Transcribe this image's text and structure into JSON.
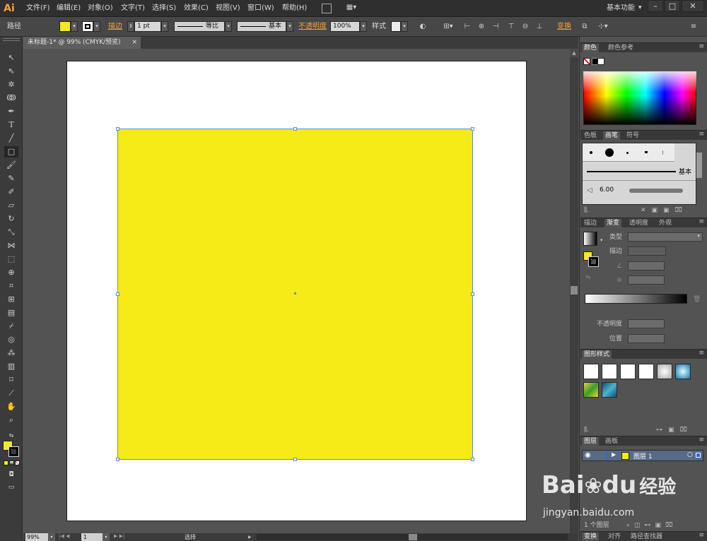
{
  "menubar": {
    "logo": "Ai",
    "items": [
      "文件(F)",
      "编辑(E)",
      "对象(O)",
      "文字(T)",
      "选择(S)",
      "效果(C)",
      "视图(V)",
      "窗口(W)",
      "帮助(H)"
    ],
    "workspace": "基本功能",
    "window_buttons": [
      "–",
      "□",
      "✕"
    ]
  },
  "control_bar": {
    "selection_label": "路径",
    "fill_color": "#f5eb17",
    "stroke_label": "描边",
    "stroke_weight": "1 pt",
    "stroke_profile": "等比",
    "brush_def": "基本",
    "opacity_label": "不透明度",
    "opacity_value": "100%",
    "style_label": "样式",
    "transform_label": "变换"
  },
  "document": {
    "tab_title": "未标题-1* @ 99% (CMYK/预览)",
    "tab_close": "×"
  },
  "canvas": {
    "fill_color": "#f5eb17",
    "selection_color": "#5b8ed6"
  },
  "status": {
    "zoom": "99%",
    "artboard_number": "1",
    "tool_hint": "选择"
  },
  "panels": {
    "color": {
      "tabs": [
        "颜色",
        "颜色参考"
      ]
    },
    "brushes": {
      "tabs": [
        "色板",
        "画笔",
        "符号"
      ],
      "basic_label": "基本",
      "size_value": "6.00"
    },
    "gradient": {
      "tabs": [
        "描边",
        "渐变",
        "透明度",
        "外观"
      ],
      "type_label": "类型",
      "stroke_label": "描边",
      "opacity_label": "不透明度",
      "position_label": "位置"
    },
    "graphic_styles": {
      "tabs": [
        "图形样式"
      ]
    },
    "layers": {
      "tabs": [
        "图层",
        "画板"
      ],
      "layer_name": "图层 1",
      "layer_color": "#f5eb17",
      "count_label": "1 个图层"
    },
    "bottom": {
      "tabs": [
        "变换",
        "对齐",
        "路径查找器"
      ]
    }
  },
  "watermark": {
    "brand": "Bai",
    "brand2": "du",
    "cn": "经验",
    "url": "jingyan.baidu.com"
  }
}
